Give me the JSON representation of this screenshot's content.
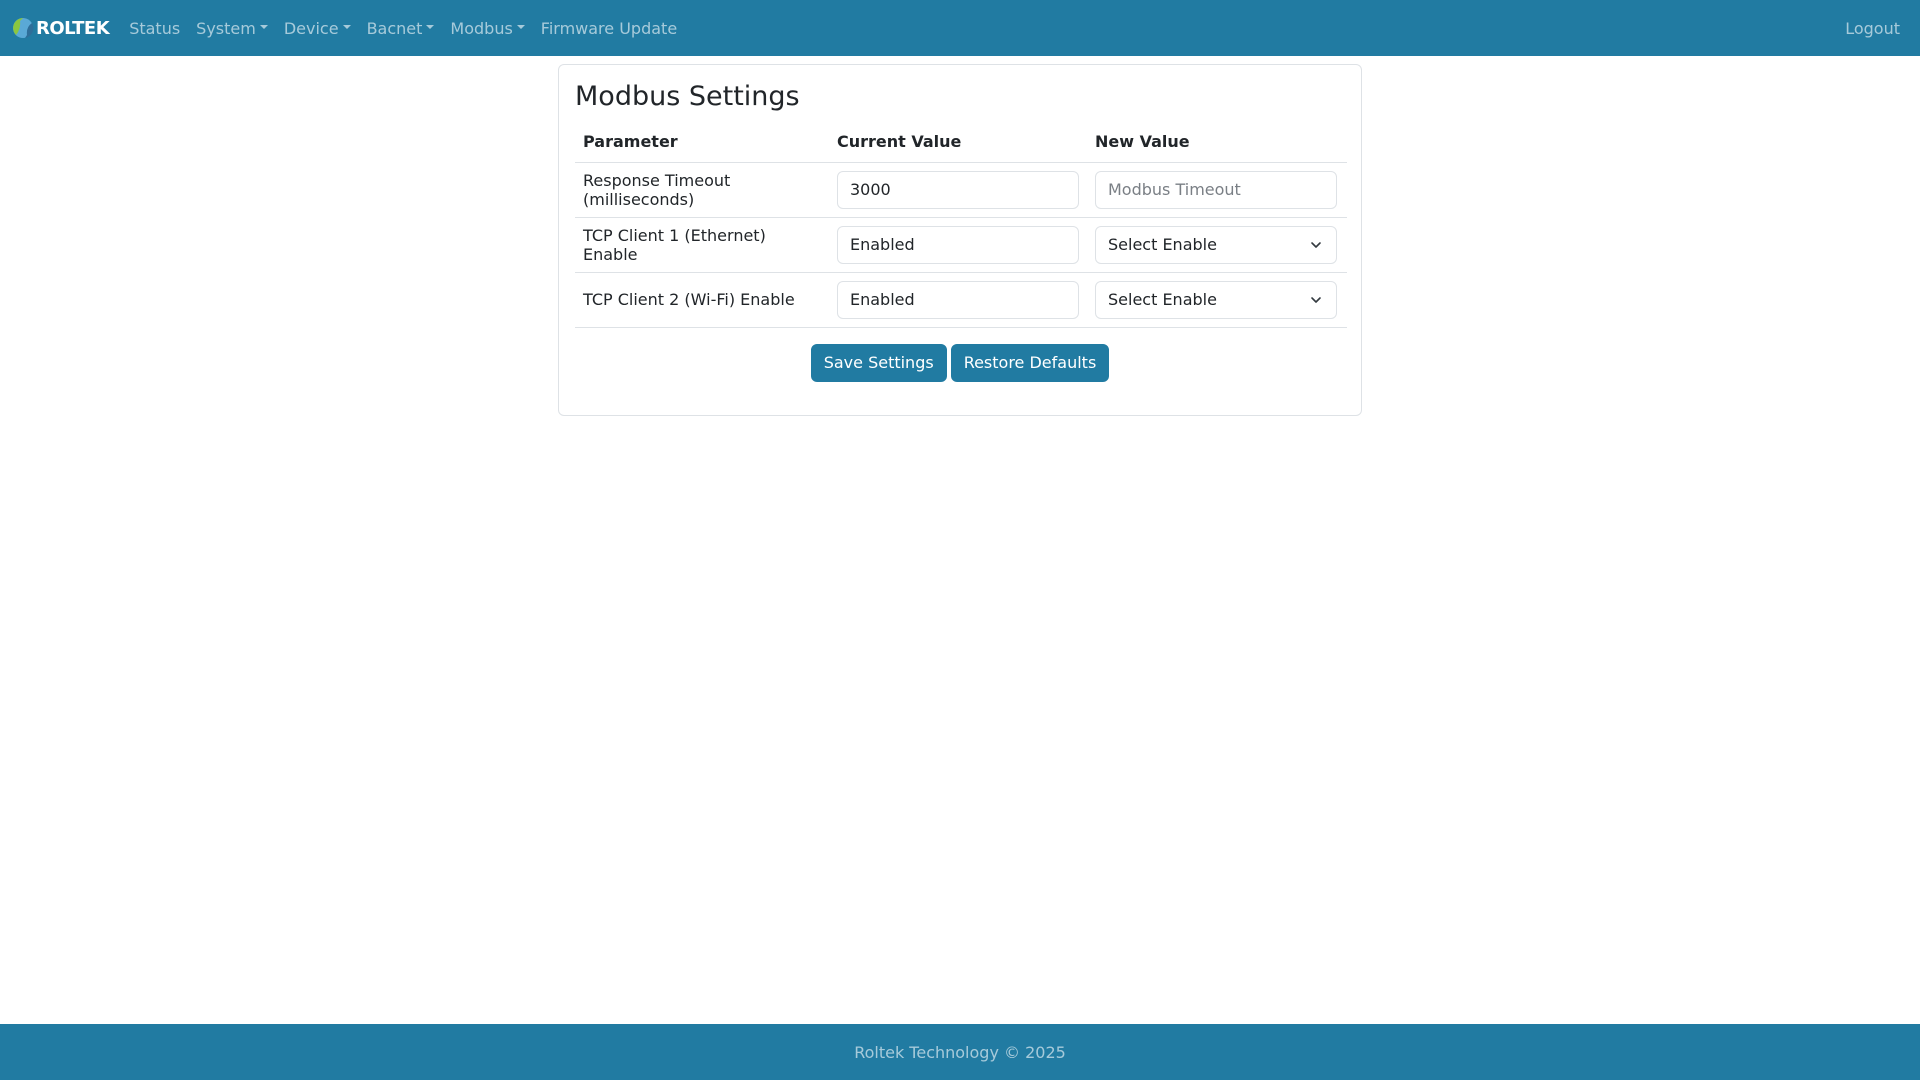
{
  "navbar": {
    "brand": "ROLTEK",
    "items": [
      {
        "label": "Status",
        "dropdown": false
      },
      {
        "label": "System",
        "dropdown": true
      },
      {
        "label": "Device",
        "dropdown": true
      },
      {
        "label": "Bacnet",
        "dropdown": true
      },
      {
        "label": "Modbus",
        "dropdown": true
      },
      {
        "label": "Firmware Update",
        "dropdown": false
      }
    ],
    "logout": "Logout"
  },
  "colors": {
    "primary": "#217ba2",
    "border": "#dee2e6"
  },
  "settings": {
    "title": "Modbus Settings",
    "columns": [
      "Parameter",
      "Current Value",
      "New Value"
    ],
    "rows": [
      {
        "parameter": "Response Timeout (milliseconds)",
        "current": "3000",
        "new_placeholder": "Modbus Timeout",
        "new_type": "input"
      },
      {
        "parameter": "TCP Client 1 (Ethernet) Enable",
        "current": "Enabled",
        "new_value": "Select Enable",
        "new_type": "select"
      },
      {
        "parameter": "TCP Client 2 (Wi-Fi) Enable",
        "current": "Enabled",
        "new_value": "Select Enable",
        "new_type": "select"
      }
    ],
    "save_label": "Save Settings",
    "restore_label": "Restore Defaults"
  },
  "footer": {
    "text": "Roltek Technology © 2025"
  }
}
